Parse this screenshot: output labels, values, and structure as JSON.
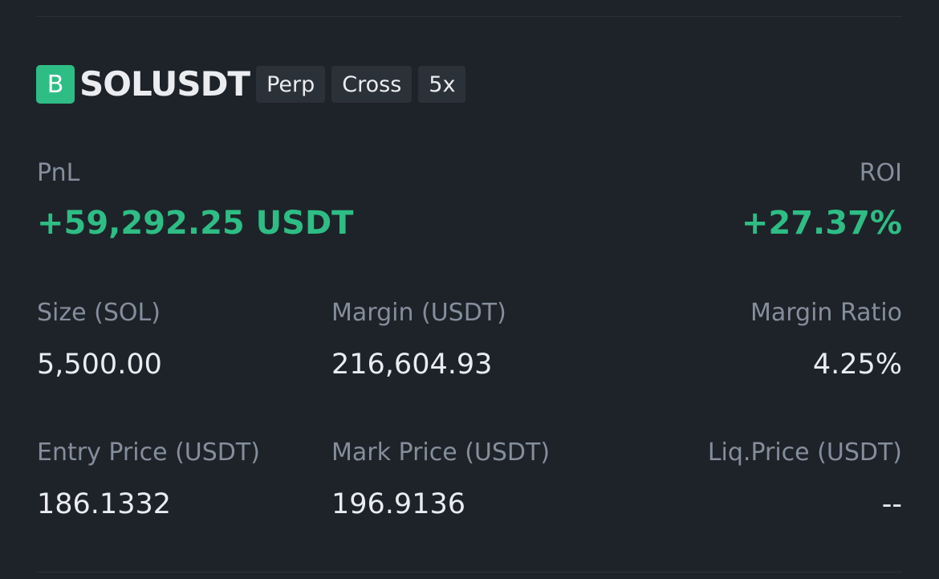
{
  "position": {
    "exchange_badge": "B",
    "symbol": "SOLUSDT",
    "tags": [
      "Perp",
      "Cross",
      "5x"
    ],
    "pnl_label": "PnL",
    "pnl_value": "+59,292.25 USDT",
    "roi_label": "ROI",
    "roi_value": "+27.37%",
    "size_label": "Size (SOL)",
    "size_value": "5,500.00",
    "margin_label": "Margin (USDT)",
    "margin_value": "216,604.93",
    "margin_ratio_label": "Margin Ratio",
    "margin_ratio_value": "4.25%",
    "entry_label": "Entry Price (USDT)",
    "entry_value": "186.1332",
    "mark_label": "Mark Price (USDT)",
    "mark_value": "196.9136",
    "liq_label": "Liq.Price (USDT)",
    "liq_value": "--"
  },
  "colors": {
    "background": "#1e2329",
    "positive": "#2ebd85",
    "text_primary": "#eaecef",
    "text_secondary": "#848e9c",
    "tag_bg": "#2b3139"
  }
}
